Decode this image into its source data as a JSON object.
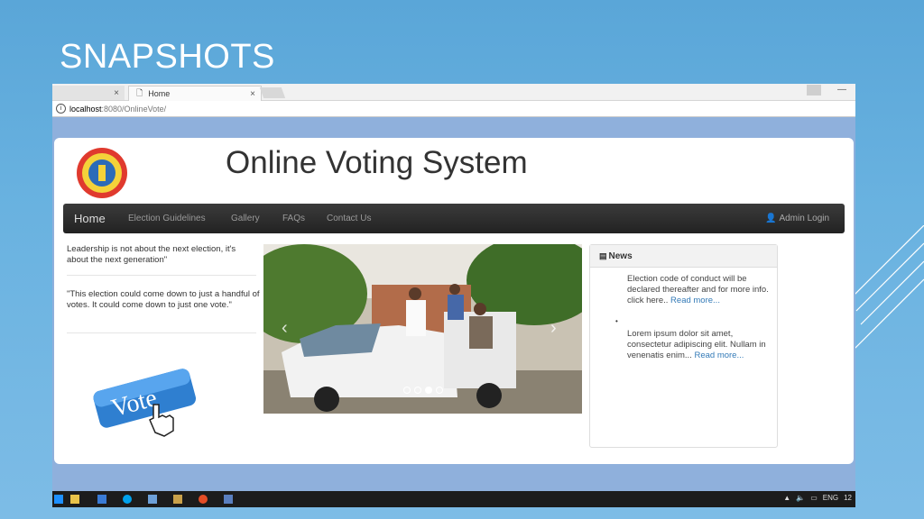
{
  "slide": {
    "title": "SNAPSHOTS"
  },
  "browser": {
    "tab_active_label": "Home",
    "close_glyph": "×",
    "url_host": "localhost",
    "url_rest": ":8080/OnlineVote/"
  },
  "site": {
    "title": "Online Voting System",
    "nav": {
      "home": "Home",
      "guidelines": "Election Guidelines",
      "gallery": "Gallery",
      "faqs": "FAQs",
      "contact": "Contact Us",
      "admin": "Admin Login"
    },
    "quotes": [
      "Leadership is not about the next election, it's about the next generation\"",
      "\"This election could come down to just a handful of votes. It could come down to just one vote.\""
    ],
    "vote_button_text": "Vote",
    "carousel": {
      "slides": 4,
      "active": 2
    },
    "news": {
      "heading": "News",
      "items": [
        {
          "text": "Election code of conduct will be declared thereafter and for more info. click here..",
          "link": "Read more..."
        },
        {
          "text": "Lorem ipsum dolor sit amet, consectetur adipiscing elit. Nullam in venenatis enim...",
          "link": "Read more..."
        }
      ]
    }
  },
  "taskbar": {
    "lang": "ENG",
    "time": "12"
  },
  "colors": {
    "navbar": "#2b2b2b",
    "link": "#337ab7",
    "slide_bg": "#69b2e0"
  }
}
